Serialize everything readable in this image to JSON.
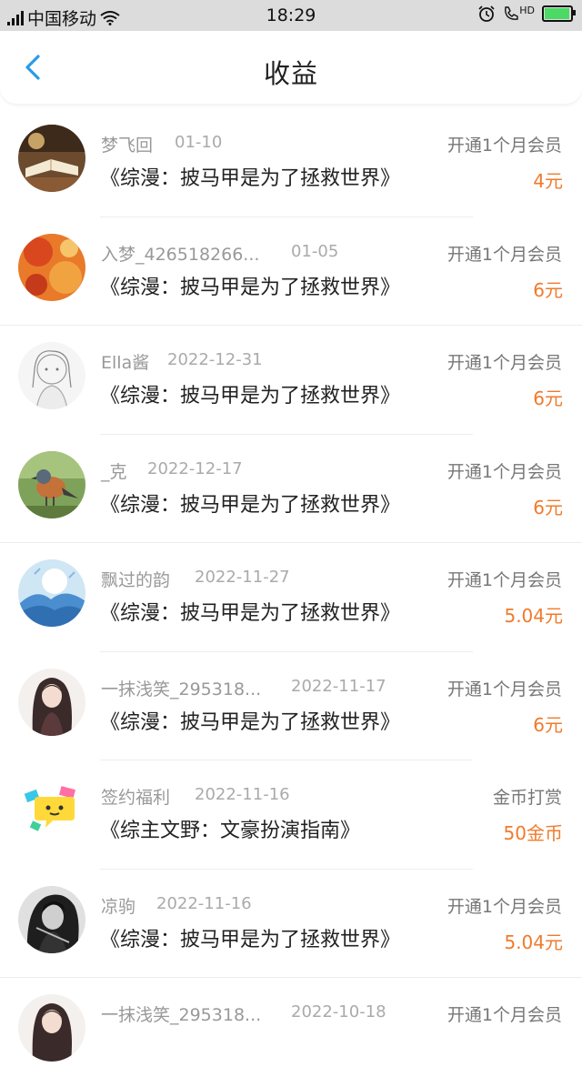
{
  "status_bar": {
    "carrier": "中国移动",
    "network": "4G",
    "time": "18:29",
    "hd": "HD"
  },
  "header": {
    "title": "收益"
  },
  "income_list": [
    {
      "name": "梦飞回",
      "date": "01-10",
      "book": "《综漫：披马甲是为了拯救世界》",
      "type": "开通1个月会员",
      "amount": "4元",
      "avatar": "book-photo-avatar"
    },
    {
      "name": "入梦_426518266...",
      "date": "01-05",
      "book": "《综漫：披马甲是为了拯救世界》",
      "type": "开通1个月会员",
      "amount": "6元",
      "avatar": "autumn-leaves-avatar"
    },
    {
      "name": "Ella酱",
      "date": "2022-12-31",
      "book": "《综漫：披马甲是为了拯救世界》",
      "type": "开通1个月会员",
      "amount": "6元",
      "avatar": "sketch-girl-avatar"
    },
    {
      "name": "_克",
      "date": "2022-12-17",
      "book": "《综漫：披马甲是为了拯救世界》",
      "type": "开通1个月会员",
      "amount": "6元",
      "avatar": "bird-avatar"
    },
    {
      "name": "飘过的韵",
      "date": "2022-11-27",
      "book": "《综漫：披马甲是为了拯救世界》",
      "type": "开通1个月会员",
      "amount": "5.04元",
      "avatar": "blue-watercolor-avatar"
    },
    {
      "name": "一抹浅笑_295318...",
      "date": "2022-11-17",
      "book": "《综漫：披马甲是为了拯救世界》",
      "type": "开通1个月会员",
      "amount": "6元",
      "avatar": "anime-girl-avatar"
    },
    {
      "name": "签约福利",
      "date": "2022-11-16",
      "book": "《综主文野：文豪扮演指南》",
      "type": "金币打赏",
      "amount": "50金币",
      "avatar": "chat-bubble-avatar"
    },
    {
      "name": "凉驹",
      "date": "2022-11-16",
      "book": "《综漫：披马甲是为了拯救世界》",
      "type": "开通1个月会员",
      "amount": "5.04元",
      "avatar": "dark-anime-avatar"
    },
    {
      "name": "一抹浅笑_295318...",
      "date": "2022-10-18",
      "book": "",
      "type": "开通1个月会员",
      "amount": "",
      "avatar": "anime-girl-avatar"
    }
  ],
  "colors": {
    "accent": "#2a9be8",
    "amount": "#f07a2b",
    "battery": "#4cd964"
  }
}
